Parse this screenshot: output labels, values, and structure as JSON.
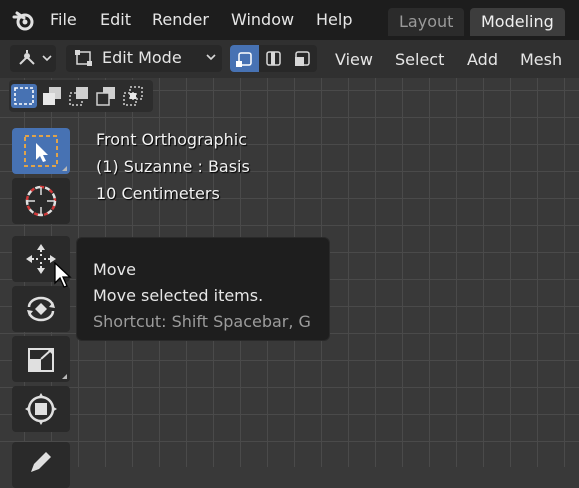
{
  "menubar": {
    "items": [
      "File",
      "Edit",
      "Render",
      "Window",
      "Help"
    ],
    "workspaces": [
      {
        "label": "Layout",
        "active": false
      },
      {
        "label": "Modeling",
        "active": true
      }
    ]
  },
  "header": {
    "mode_label": "Edit Mode",
    "menus": [
      "View",
      "Select",
      "Add",
      "Mesh"
    ]
  },
  "viewport_info": {
    "line1": "Front Orthographic",
    "line2": "(1) Suzanne : Basis",
    "line3": "10 Centimeters"
  },
  "tooltip": {
    "title": "Move",
    "description": "Move selected items.",
    "shortcut": "Shortcut: Shift Spacebar, G"
  },
  "colors": {
    "accent": "#4772b3",
    "select_box_dash": "#e0a34a",
    "background": "#393939"
  },
  "tools": [
    {
      "name": "select-box",
      "icon": "select-box-icon",
      "active": true
    },
    {
      "name": "cursor",
      "icon": "cursor-target-icon",
      "active": false
    },
    {
      "name": "move",
      "icon": "move-icon",
      "active": false
    },
    {
      "name": "rotate",
      "icon": "rotate-icon",
      "active": false
    },
    {
      "name": "scale",
      "icon": "scale-icon",
      "active": false
    },
    {
      "name": "transform",
      "icon": "transform-icon",
      "active": false
    },
    {
      "name": "annotate",
      "icon": "pencil-icon",
      "active": false
    }
  ]
}
